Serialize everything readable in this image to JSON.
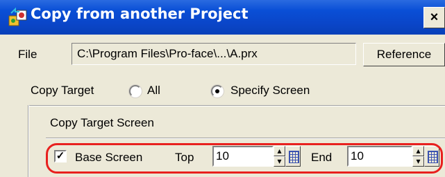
{
  "window": {
    "title": "Copy from another Project",
    "close_label": "×"
  },
  "file": {
    "label": "File",
    "path": "C:\\Program Files\\Pro-face\\...\\A.prx",
    "reference_button": "Reference"
  },
  "copy_target": {
    "label": "Copy Target",
    "options": [
      {
        "label": "All",
        "selected": false
      },
      {
        "label": "Specify Screen",
        "selected": true
      }
    ]
  },
  "copy_target_screen": {
    "label": "Copy Target Screen",
    "base_screen": {
      "label": "Base Screen",
      "checked": true,
      "check_mark": "✓",
      "top_label": "Top",
      "top_value": "10",
      "end_label": "End",
      "end_value": "10"
    }
  },
  "colors": {
    "title_bar": "#0a4fd6",
    "highlight_frame": "#e8201e",
    "dialog_bg": "#ece9d8"
  }
}
